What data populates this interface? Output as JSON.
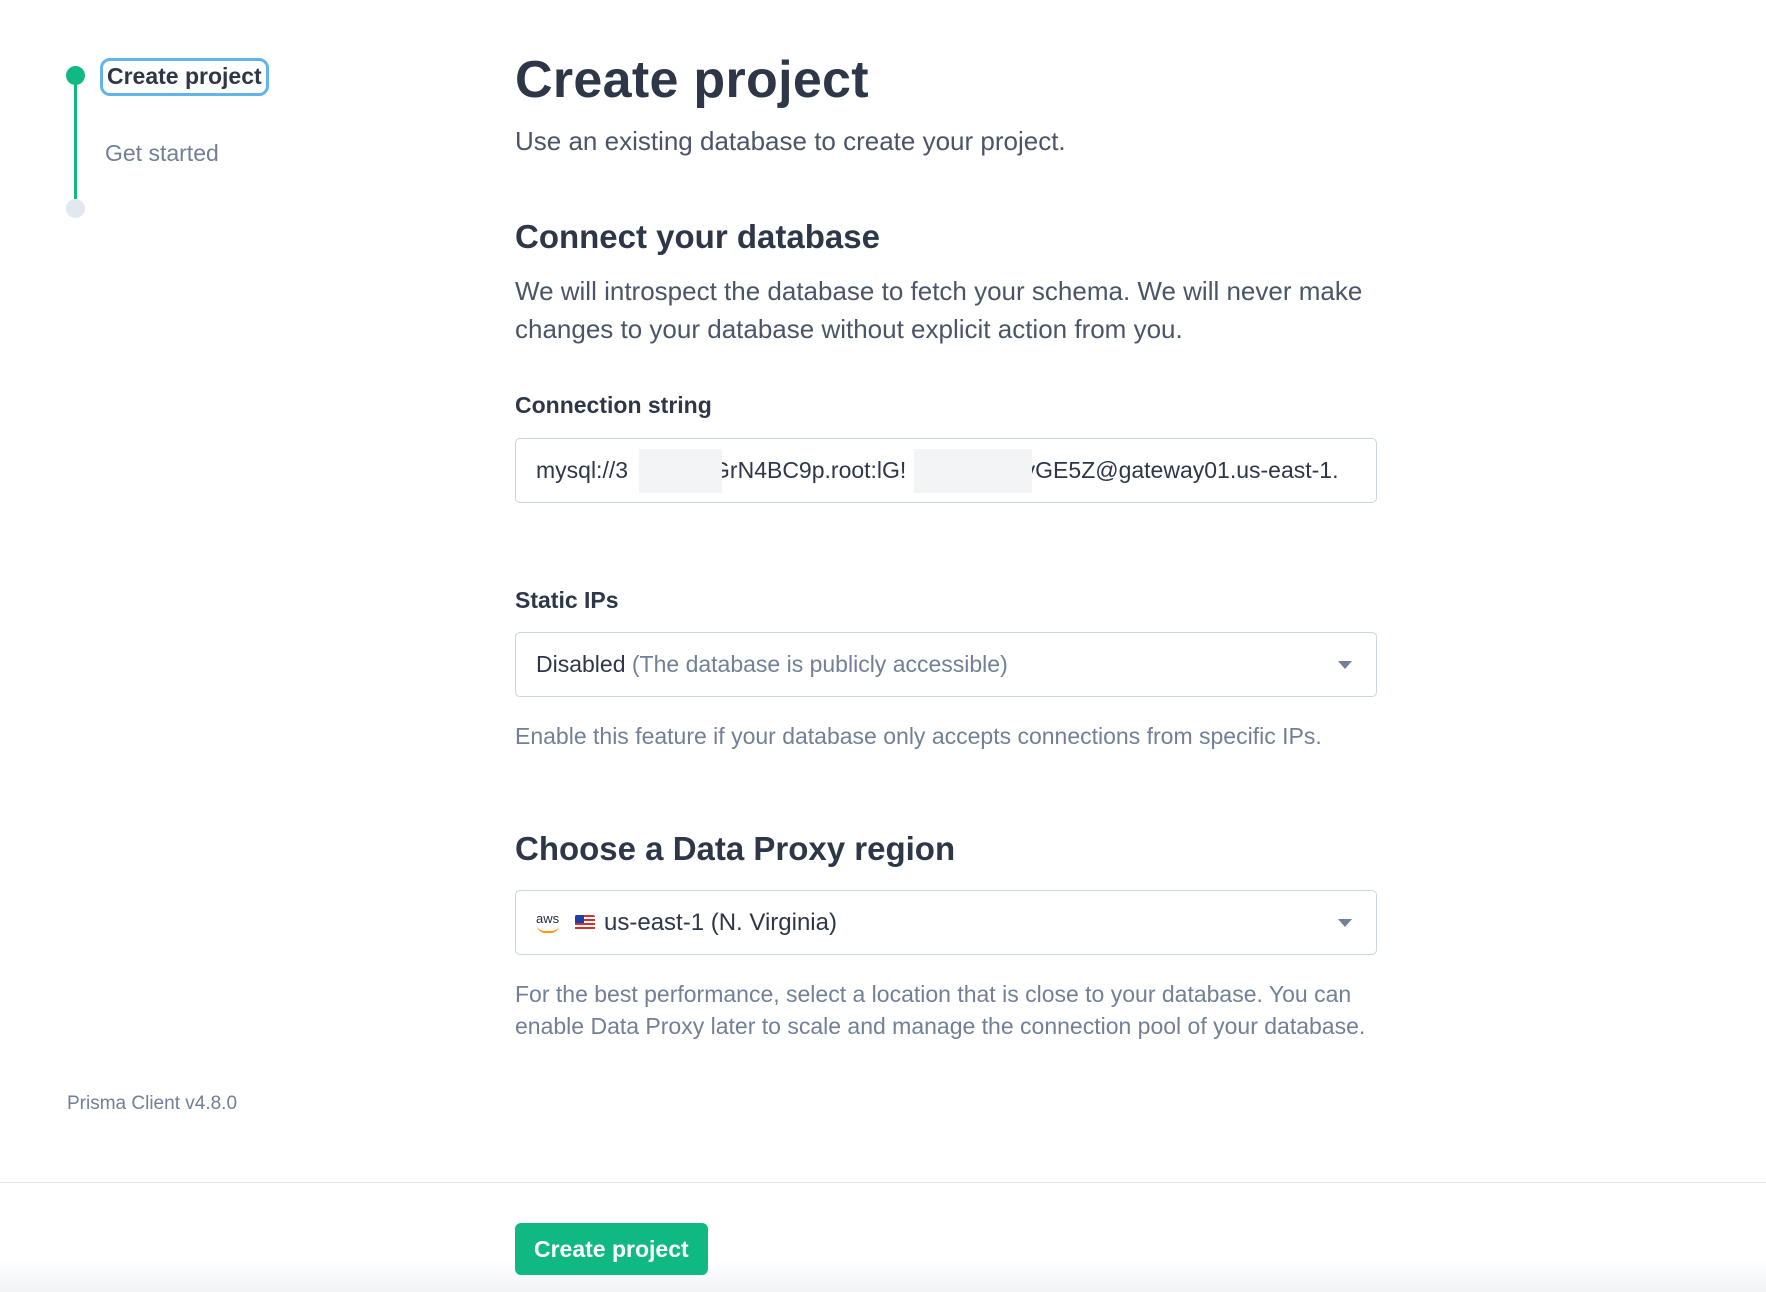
{
  "stepper": {
    "steps": [
      {
        "label": "Create project",
        "state": "active"
      },
      {
        "label": "Get started",
        "state": "inactive"
      }
    ]
  },
  "footer_meta": {
    "version": "Prisma Client v4.8.0"
  },
  "header": {
    "title": "Create project",
    "subtitle": "Use an existing database to create your project."
  },
  "connect": {
    "title": "Connect your database",
    "description": "We will introspect the database to fetch your schema. We will never make changes to your database without explicit action from you.",
    "connection_label": "Connection string",
    "connection_value": {
      "part1": "mysql://3",
      "part2": "GrN4BC9p.root:lG!",
      "part3": "SyGE5Z@gateway01.us-east-1."
    },
    "static_ips_label": "Static IPs",
    "static_ips_value": "Disabled",
    "static_ips_note": "(The database is publicly accessible)",
    "static_ips_help": "Enable this feature if your database only accepts connections from specific IPs."
  },
  "proxy": {
    "title": "Choose a Data Proxy region",
    "provider_icon": "aws-icon",
    "provider_word": "aws",
    "flag_icon": "us-flag-icon",
    "region_value": "us-east-1 (N. Virginia)",
    "help": "For the best performance, select a location that is close to your database. You can enable Data Proxy later to scale and manage the connection pool of your database."
  },
  "actions": {
    "create_label": "Create project"
  },
  "colors": {
    "accent": "#10b981",
    "focus_ring": "#63b3ed",
    "text": "#2d3748",
    "muted": "#718096"
  }
}
